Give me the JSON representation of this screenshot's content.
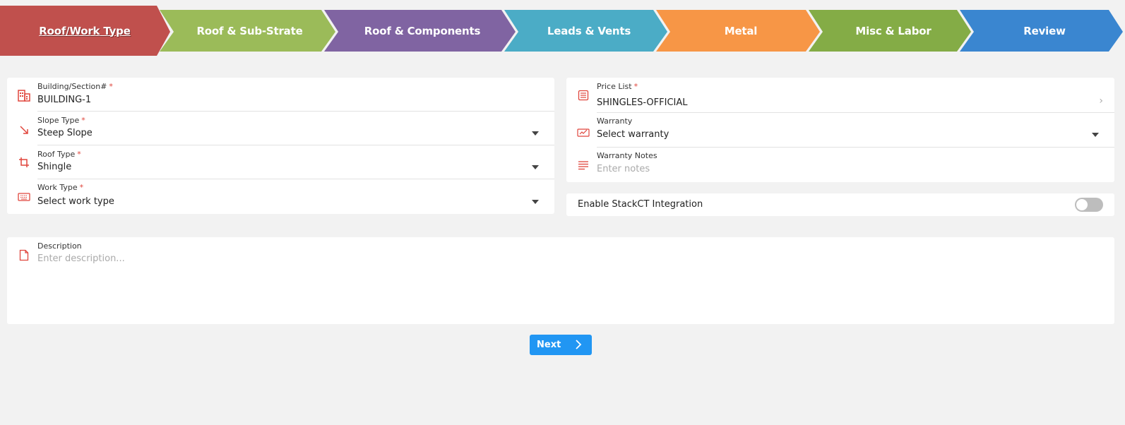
{
  "steps": [
    {
      "label": "Roof/Work Type",
      "color": "#c0504d",
      "active": true
    },
    {
      "label": "Roof & Sub-Strate",
      "color": "#9bbb59"
    },
    {
      "label": "Roof & Components",
      "color": "#8064a2"
    },
    {
      "label": "Leads & Vents",
      "color": "#4bacc6"
    },
    {
      "label": "Metal",
      "color": "#f79646"
    },
    {
      "label": "Misc & Labor",
      "color": "#84ac46"
    },
    {
      "label": "Review",
      "color": "#3a86d0"
    }
  ],
  "left_card": {
    "building": {
      "label": "Building/Section#",
      "required": "*",
      "value": "BUILDING-1",
      "icon": "building-icon"
    },
    "slope_type": {
      "label": "Slope Type",
      "required": "*",
      "value": "Steep Slope",
      "icon": "slope-arrow-icon"
    },
    "roof_type": {
      "label": "Roof Type",
      "required": "*",
      "value": "Shingle",
      "icon": "crop-icon"
    },
    "work_type": {
      "label": "Work Type",
      "required": "*",
      "value": "Select work type",
      "icon": "keyboard-icon"
    }
  },
  "right_card": {
    "price_list": {
      "label": "Price List",
      "required": "*",
      "value": "SHINGLES-OFFICIAL",
      "icon": "list-icon"
    },
    "warranty": {
      "label": "Warranty",
      "value": "Select warranty",
      "icon": "signature-icon"
    },
    "warranty_notes": {
      "label": "Warranty Notes",
      "placeholder": "Enter notes",
      "icon": "notes-icon"
    }
  },
  "stackct": {
    "label": "Enable StackCT Integration",
    "enabled": false
  },
  "description": {
    "label": "Description",
    "placeholder": "Enter description...",
    "icon": "document-icon"
  },
  "next_button": {
    "label": "Next"
  },
  "colors": {
    "accent": "#e0453c",
    "primary": "#2196f3"
  }
}
